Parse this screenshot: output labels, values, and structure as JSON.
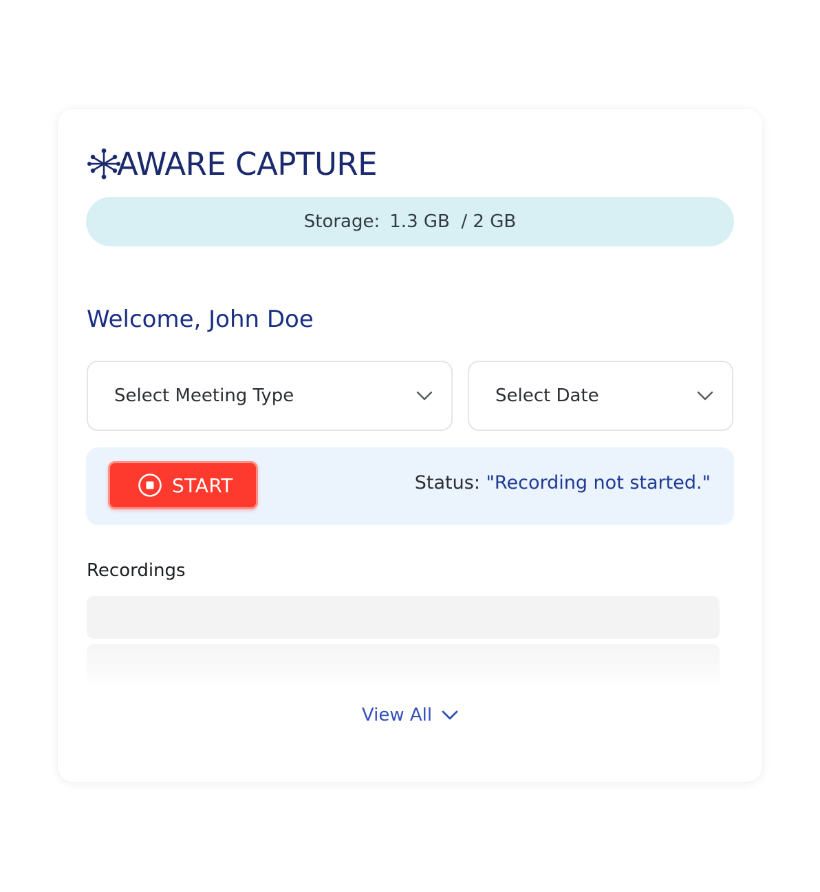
{
  "app": {
    "logo_text": "AWARE CAPTURE"
  },
  "storage": {
    "label": "Storage:",
    "value": "1.3 GB  / 2 GB",
    "used_gb": 1.3,
    "total_gb": 2
  },
  "welcome": {
    "text": "Welcome, John Doe"
  },
  "filters": {
    "meeting_type_label": "Select Meeting Type",
    "date_label": "Select Date"
  },
  "recorder": {
    "start_label": "START",
    "status_prefix": "Status:",
    "status_value": "\"Recording not started.\""
  },
  "recordings": {
    "title": "Recordings",
    "view_all_label": "View All"
  },
  "colors": {
    "brand": "#1a2a6c",
    "storage_bg": "#d8f0f4",
    "panel_bg": "#ebf3fd",
    "start_button": "#fd3a2d",
    "link": "#3350b8"
  },
  "icons": [
    "snowflake-logo-icon",
    "chevron-down-icon",
    "stop-circle-icon",
    "chevron-down-blue-icon"
  ]
}
